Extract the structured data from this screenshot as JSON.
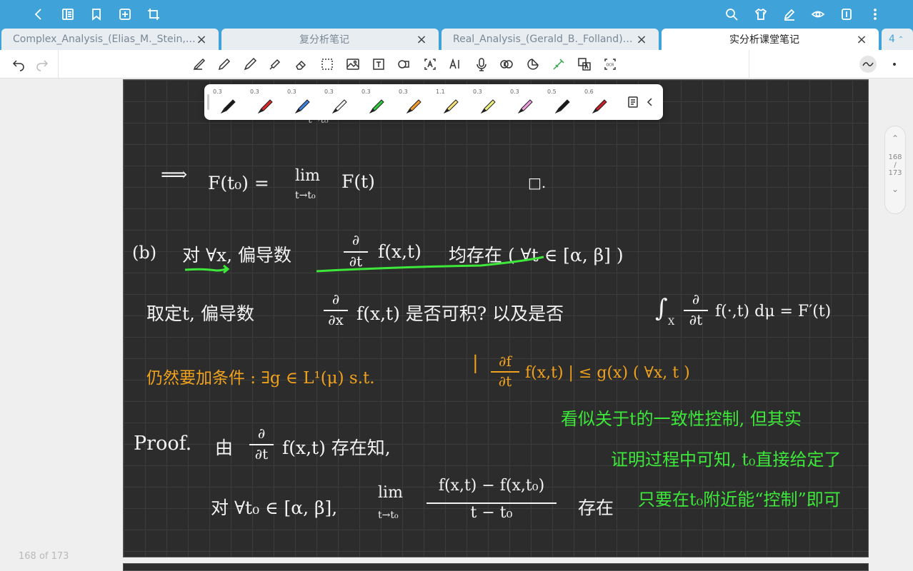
{
  "tabs": [
    {
      "label": "Complex_Analysis_(Elias_M._Stein,_..."
    },
    {
      "label": "复分析笔记"
    },
    {
      "label": "Real_Analysis_(Gerald_B._Folland)_(..."
    },
    {
      "label": "实分析课堂笔记"
    }
  ],
  "tab_count": "4",
  "colors": {
    "palette": [
      "#e8352e",
      "#2b64e6",
      "#b63be0",
      "#39d43a"
    ]
  },
  "pens": [
    {
      "width": "0.3",
      "color": "#1a1a1a"
    },
    {
      "width": "0.3",
      "color": "#d8282c"
    },
    {
      "width": "0.3",
      "color": "#3d80e0"
    },
    {
      "width": "0.3",
      "color": "#f5f5f5"
    },
    {
      "width": "0.3",
      "color": "#2ec83c"
    },
    {
      "width": "0.3",
      "color": "#f29a2e"
    },
    {
      "width": "1.1",
      "color": "#f3e27a"
    },
    {
      "width": "0.3",
      "color": "#eef07a"
    },
    {
      "width": "0.3",
      "color": "#f09ee0"
    },
    {
      "width": "0.5",
      "color": "#1a1a1a"
    },
    {
      "width": "0.6",
      "color": "#c8202a"
    }
  ],
  "scroll": {
    "current": "168",
    "sep": "/",
    "total": "173"
  },
  "footer": {
    "page_label": "168 of 173"
  },
  "notes": {
    "line1_arrow": "⟹",
    "line1_lhs": "F(t₀) =",
    "line1_lim": "lim",
    "line1_sub": "t→t₀",
    "line1_rhs": "F(t)",
    "line1_qed": "□.",
    "line2_label": "(b)",
    "line2_text": "对 ∀x,  偏导数",
    "line2_frac_num": "∂",
    "line2_frac_den": "∂t",
    "line2_func": "f(x,t)",
    "line2_tail": "均存在  ( ∀t ∈ [α, β] )",
    "line3_text": "取定t,  偏导数",
    "line3_frac_num": "∂",
    "line3_frac_den": "∂x",
    "line3_mid": "f(x,t)  是否可积?  以及是否",
    "line3_int": "∫",
    "line3_intsub": "X",
    "line3_frac2_num": "∂",
    "line3_frac2_den": "∂t",
    "line3_end": "f(·,t) dμ = F′(t)",
    "line4_text": "仍然要加条件 :  ∃g ∈ L¹(μ)   s.t.",
    "line4_frac_num": "∂f",
    "line4_frac_den": "∂t",
    "line4_end": "f(x,t) |  ≤  g(x)      ( ∀x, t )",
    "green1": "看似关于t的一致性控制, 但其实",
    "green2": "证明过程中可知, t₀直接给定了",
    "green3": "只要在t₀附近能“控制”即可",
    "proof_label": "Proof.",
    "proof_text": "由",
    "proof_frac_num": "∂",
    "proof_frac_den": "∂t",
    "proof_tail": "f(x,t) 存在知,",
    "last_text": "对 ∀t₀ ∈ [α, β],",
    "last_lim": "lim",
    "last_sub": "t→t₀",
    "last_num": "f(x,t) − f(x,t₀)",
    "last_den": "t − t₀",
    "last_tail": "存在"
  }
}
